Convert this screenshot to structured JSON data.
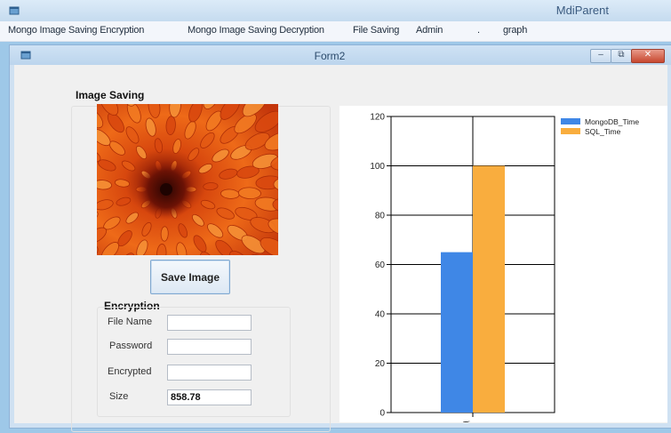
{
  "mdi": {
    "title": "MdiParent",
    "menu": [
      {
        "label": "Mongo Image Saving Encryption"
      },
      {
        "label": "Mongo Image Saving Decryption"
      },
      {
        "label": "File Saving"
      },
      {
        "label": "Admin"
      },
      {
        "label": "."
      },
      {
        "label": "graph"
      }
    ]
  },
  "form": {
    "title": "Form2",
    "image_group_title": "Image Saving",
    "save_button_label": "Save Image",
    "encryption": {
      "title": "Encryption",
      "file_name_label": "File Name",
      "file_name_value": "",
      "password_label": "Password",
      "password_value": "",
      "encrypted_label": "Encrypted",
      "encrypted_value": "",
      "size_label": "Size",
      "size_value": "858.78"
    }
  },
  "chart_data": {
    "type": "bar",
    "categories": [
      "Time"
    ],
    "series": [
      {
        "name": "MongoDB_Time",
        "values": [
          65
        ],
        "color": "#3f87e6"
      },
      {
        "name": "SQL_Time",
        "values": [
          100
        ],
        "color": "#f9ad3e"
      }
    ],
    "xlabel": "",
    "ylabel": "",
    "ylim": [
      0,
      120
    ],
    "yticks": [
      0,
      20,
      40,
      60,
      80,
      100,
      120
    ],
    "grid": true,
    "legend": "top-right"
  }
}
